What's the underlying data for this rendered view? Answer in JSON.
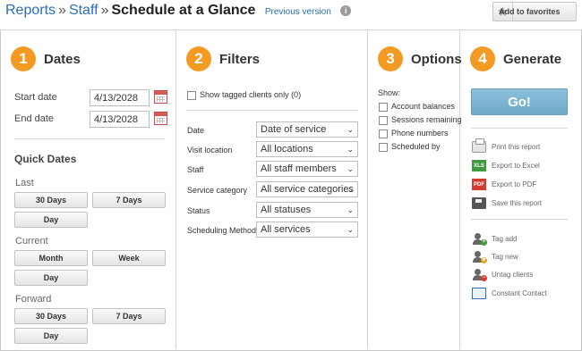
{
  "header": {
    "crumb_reports": "Reports",
    "crumb_sep": "»",
    "crumb_staff": "Staff",
    "title": "Schedule at a Glance",
    "previous_version": "Previous version",
    "info_glyph": "i",
    "favorites": "Add to favorites",
    "star_glyph": "★"
  },
  "dates": {
    "step": "1",
    "heading": "Dates",
    "start_label": "Start date",
    "start_value": "4/13/2028",
    "end_label": "End date",
    "end_value": "4/13/2028",
    "quick_heading": "Quick Dates",
    "last_label": "Last",
    "last_buttons": [
      "30 Days",
      "7 Days",
      "Day"
    ],
    "current_label": "Current",
    "current_buttons": [
      "Month",
      "Week",
      "Day"
    ],
    "forward_label": "Forward",
    "forward_buttons": [
      "30 Days",
      "7 Days",
      "Day"
    ]
  },
  "filters": {
    "step": "2",
    "heading": "Filters",
    "show_tagged": "Show tagged clients only (0)",
    "rows": [
      {
        "label": "Date",
        "value": "Date of service"
      },
      {
        "label": "Visit location",
        "value": "All locations"
      },
      {
        "label": "Staff",
        "value": "All staff members"
      },
      {
        "label": "Service category",
        "value": "All service categories"
      },
      {
        "label": "Status",
        "value": "All statuses"
      },
      {
        "label": "Scheduling Method",
        "value": "All services"
      }
    ],
    "chevron_glyph": "⌄"
  },
  "options": {
    "step": "3",
    "heading": "Options",
    "show_label": "Show:",
    "items": [
      "Account balances",
      "Sessions remaining",
      "Phone numbers",
      "Scheduled by"
    ]
  },
  "generate": {
    "step": "4",
    "heading": "Generate",
    "go": "Go!",
    "actions": [
      "Print this report",
      "Export to Excel",
      "Export to PDF",
      "Save this report"
    ],
    "xls_glyph": "XLS",
    "pdf_glyph": "PDF",
    "tag_actions": [
      "Tag add",
      "Tag new",
      "Untag clients",
      "Constant Contact"
    ],
    "tag_add_glyph": "+",
    "tag_new_glyph": "★",
    "untag_glyph": "−"
  }
}
